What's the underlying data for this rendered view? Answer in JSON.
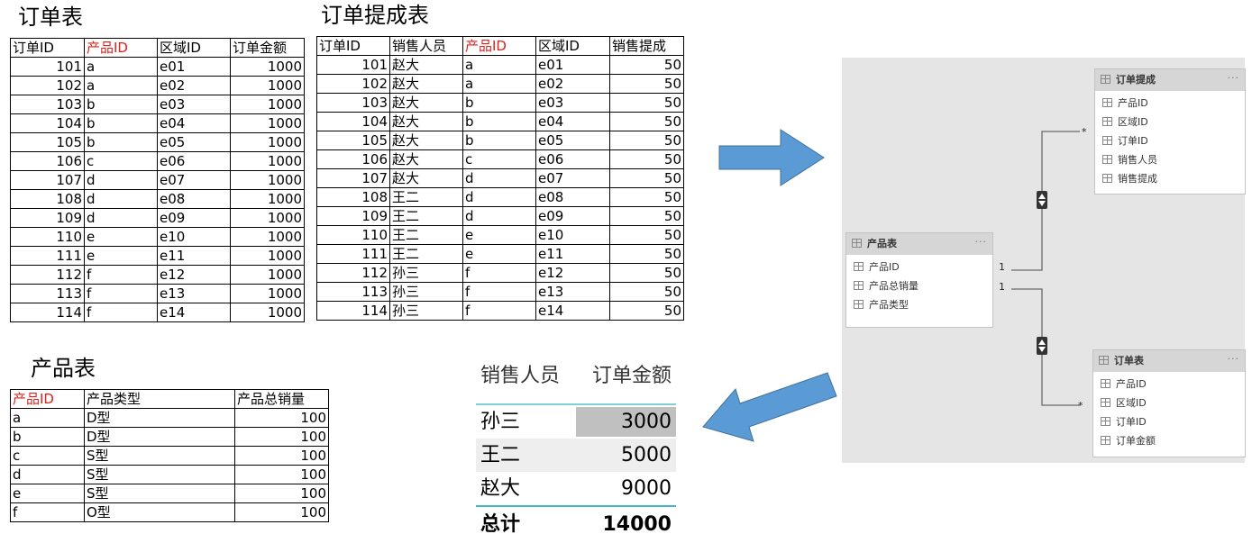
{
  "orders": {
    "title": "订单表",
    "columns": [
      "订单ID",
      "产品ID",
      "区域ID",
      "订单金额"
    ],
    "rows": [
      [
        "101",
        "a",
        "e01",
        "1000"
      ],
      [
        "102",
        "a",
        "e02",
        "1000"
      ],
      [
        "103",
        "b",
        "e03",
        "1000"
      ],
      [
        "104",
        "b",
        "e04",
        "1000"
      ],
      [
        "105",
        "b",
        "e05",
        "1000"
      ],
      [
        "106",
        "c",
        "e06",
        "1000"
      ],
      [
        "107",
        "d",
        "e07",
        "1000"
      ],
      [
        "108",
        "d",
        "e08",
        "1000"
      ],
      [
        "109",
        "d",
        "e09",
        "1000"
      ],
      [
        "110",
        "e",
        "e10",
        "1000"
      ],
      [
        "111",
        "e",
        "e11",
        "1000"
      ],
      [
        "112",
        "f",
        "e12",
        "1000"
      ],
      [
        "113",
        "f",
        "e13",
        "1000"
      ],
      [
        "114",
        "f",
        "e14",
        "1000"
      ]
    ]
  },
  "commission": {
    "title": "订单提成表",
    "columns": [
      "订单ID",
      "销售人员",
      "产品ID",
      "区域ID",
      "销售提成"
    ],
    "rows": [
      [
        "101",
        "赵大",
        "a",
        "e01",
        "50"
      ],
      [
        "102",
        "赵大",
        "a",
        "e02",
        "50"
      ],
      [
        "103",
        "赵大",
        "b",
        "e03",
        "50"
      ],
      [
        "104",
        "赵大",
        "b",
        "e04",
        "50"
      ],
      [
        "105",
        "赵大",
        "b",
        "e05",
        "50"
      ],
      [
        "106",
        "赵大",
        "c",
        "e06",
        "50"
      ],
      [
        "107",
        "赵大",
        "d",
        "e07",
        "50"
      ],
      [
        "108",
        "王二",
        "d",
        "e08",
        "50"
      ],
      [
        "109",
        "王二",
        "d",
        "e09",
        "50"
      ],
      [
        "110",
        "王二",
        "e",
        "e10",
        "50"
      ],
      [
        "111",
        "王二",
        "e",
        "e11",
        "50"
      ],
      [
        "112",
        "孙三",
        "f",
        "e12",
        "50"
      ],
      [
        "113",
        "孙三",
        "f",
        "e13",
        "50"
      ],
      [
        "114",
        "孙三",
        "f",
        "e14",
        "50"
      ]
    ]
  },
  "products": {
    "title": "产品表",
    "columns": [
      "产品ID",
      "产品类型",
      "产品总销量"
    ],
    "rows": [
      [
        "a",
        "D型",
        "100"
      ],
      [
        "b",
        "D型",
        "100"
      ],
      [
        "c",
        "S型",
        "100"
      ],
      [
        "d",
        "S型",
        "100"
      ],
      [
        "e",
        "S型",
        "100"
      ],
      [
        "f",
        "O型",
        "100"
      ]
    ]
  },
  "model": {
    "cards": [
      {
        "title": "订单提成",
        "fields": [
          "产品ID",
          "区域ID",
          "订单ID",
          "销售人员",
          "销售提成"
        ]
      },
      {
        "title": "产品表",
        "fields": [
          "产品ID",
          "产品总销量",
          "产品类型"
        ]
      },
      {
        "title": "订单表",
        "fields": [
          "产品ID",
          "区域ID",
          "订单ID",
          "订单金额"
        ]
      }
    ],
    "card_menu": "···",
    "one_label": "1",
    "many_label": "*"
  },
  "result": {
    "headers": [
      "销售人员",
      "订单金额"
    ],
    "rows": [
      [
        "孙三",
        "3000"
      ],
      [
        "王二",
        "5000"
      ],
      [
        "赵大",
        "9000"
      ]
    ],
    "total": [
      "总计",
      "14000"
    ]
  },
  "colors": {
    "key_red": "#e0201a",
    "arrow_blue": "#5b9bd5",
    "highlight_gray": "#c0c0c0",
    "total_line": "#46b6c4"
  }
}
